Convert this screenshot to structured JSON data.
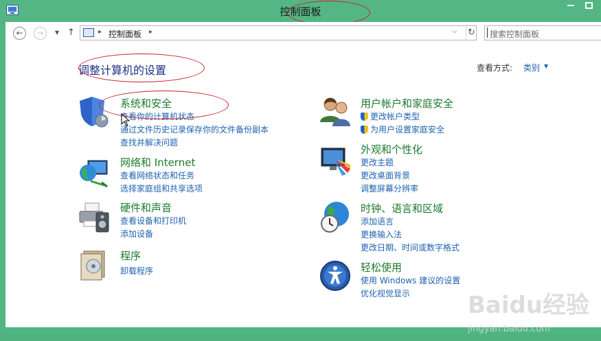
{
  "window": {
    "title": "控制面板"
  },
  "address": {
    "crumb": "控制面板",
    "search_placeholder": "搜索控制面板"
  },
  "page": {
    "heading": "调整计算机的设置",
    "viewby_label": "查看方式:",
    "viewby_value": "类别"
  },
  "categories": [
    {
      "title": "系统和安全",
      "links": [
        "查看你的计算机状态",
        "通过文件历史记录保存你的文件备份副本",
        "查找并解决问题"
      ]
    },
    {
      "title": "网络和 Internet",
      "links": [
        "查看网络状态和任务",
        "选择家庭组和共享选项"
      ]
    },
    {
      "title": "硬件和声音",
      "links": [
        "查看设备和打印机",
        "添加设备"
      ]
    },
    {
      "title": "程序",
      "links": [
        "卸载程序"
      ]
    },
    {
      "title": "用户帐户和家庭安全",
      "links": [
        "更改帐户类型",
        "为用户设置家庭安全"
      ]
    },
    {
      "title": "外观和个性化",
      "links": [
        "更改主题",
        "更改桌面背景",
        "调整屏幕分辨率"
      ]
    },
    {
      "title": "时钟、语言和区域",
      "links": [
        "添加语言",
        "更换输入法",
        "更改日期、时间或数字格式"
      ]
    },
    {
      "title": "轻松使用",
      "links": [
        "使用 Windows 建议的设置",
        "优化视觉显示"
      ]
    }
  ],
  "watermark": {
    "main": "Baidu经验",
    "sub": "jingyan.baidu.com"
  }
}
